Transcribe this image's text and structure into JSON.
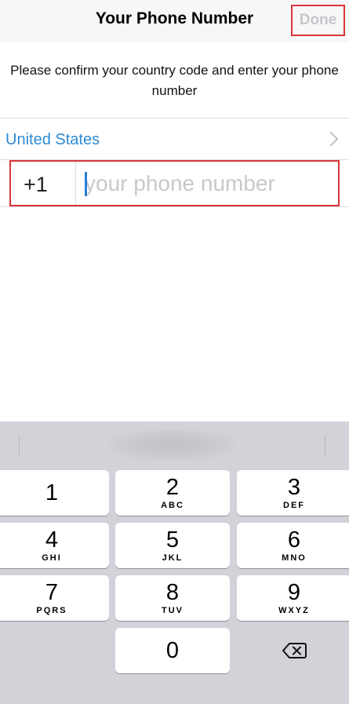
{
  "navbar": {
    "title": "Your Phone Number",
    "done_label": "Done"
  },
  "instructions": "Please confirm your country code and enter your phone number",
  "country": {
    "name": "United States"
  },
  "phone": {
    "code": "+1",
    "placeholder": "your phone number",
    "value": ""
  },
  "keypad": {
    "keys": [
      {
        "num": "1",
        "letters": ""
      },
      {
        "num": "2",
        "letters": "ABC"
      },
      {
        "num": "3",
        "letters": "DEF"
      },
      {
        "num": "4",
        "letters": "GHI"
      },
      {
        "num": "5",
        "letters": "JKL"
      },
      {
        "num": "6",
        "letters": "MNO"
      },
      {
        "num": "7",
        "letters": "PQRS"
      },
      {
        "num": "8",
        "letters": "TUV"
      },
      {
        "num": "9",
        "letters": "WXYZ"
      },
      {
        "num": "0",
        "letters": ""
      }
    ],
    "delete_icon": "backspace-icon"
  },
  "colors": {
    "accent": "#2c8bd6",
    "highlight_border": "#d9343c",
    "done_disabled": "#c7c7cc",
    "keyboard_bg": "#d1d3d9"
  }
}
